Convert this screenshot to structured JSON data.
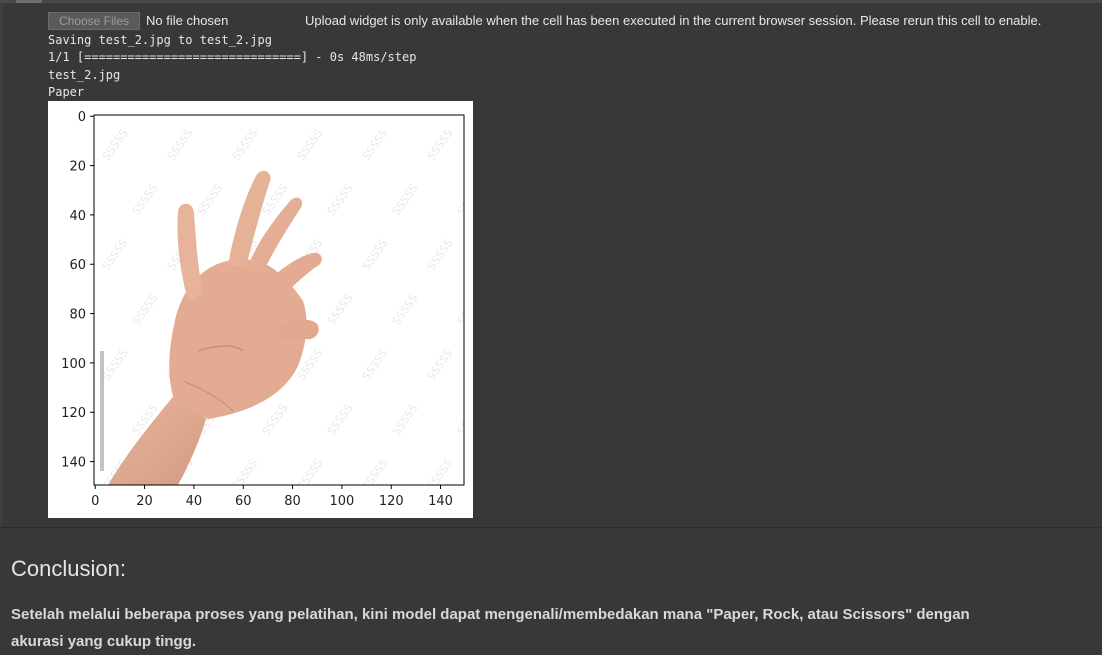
{
  "upload": {
    "button_label": "Choose Files",
    "file_status": "No file chosen",
    "note": "Upload widget is only available when the cell has been executed in the current browser session. Please rerun this cell to enable."
  },
  "output_lines": [
    "Saving test_2.jpg to test_2.jpg",
    "1/1 [==============================] - 0s 48ms/step",
    "test_2.jpg",
    "Paper"
  ],
  "plot": {
    "x_ticks": [
      "0",
      "20",
      "40",
      "60",
      "80",
      "100",
      "120",
      "140"
    ],
    "y_ticks": [
      "0",
      "20",
      "40",
      "60",
      "80",
      "100",
      "120",
      "140"
    ],
    "image_content": "hand-open-palm",
    "watermark_text": "SSSSS"
  },
  "conclusion": {
    "title": "Conclusion:",
    "line1": "Setelah melalui beberapa proses yang pelatihan, kini model dapat mengenali/membedakan mana \"Paper, Rock, atau Scissors\" dengan",
    "line2": "akurasi yang cukup tingg."
  }
}
